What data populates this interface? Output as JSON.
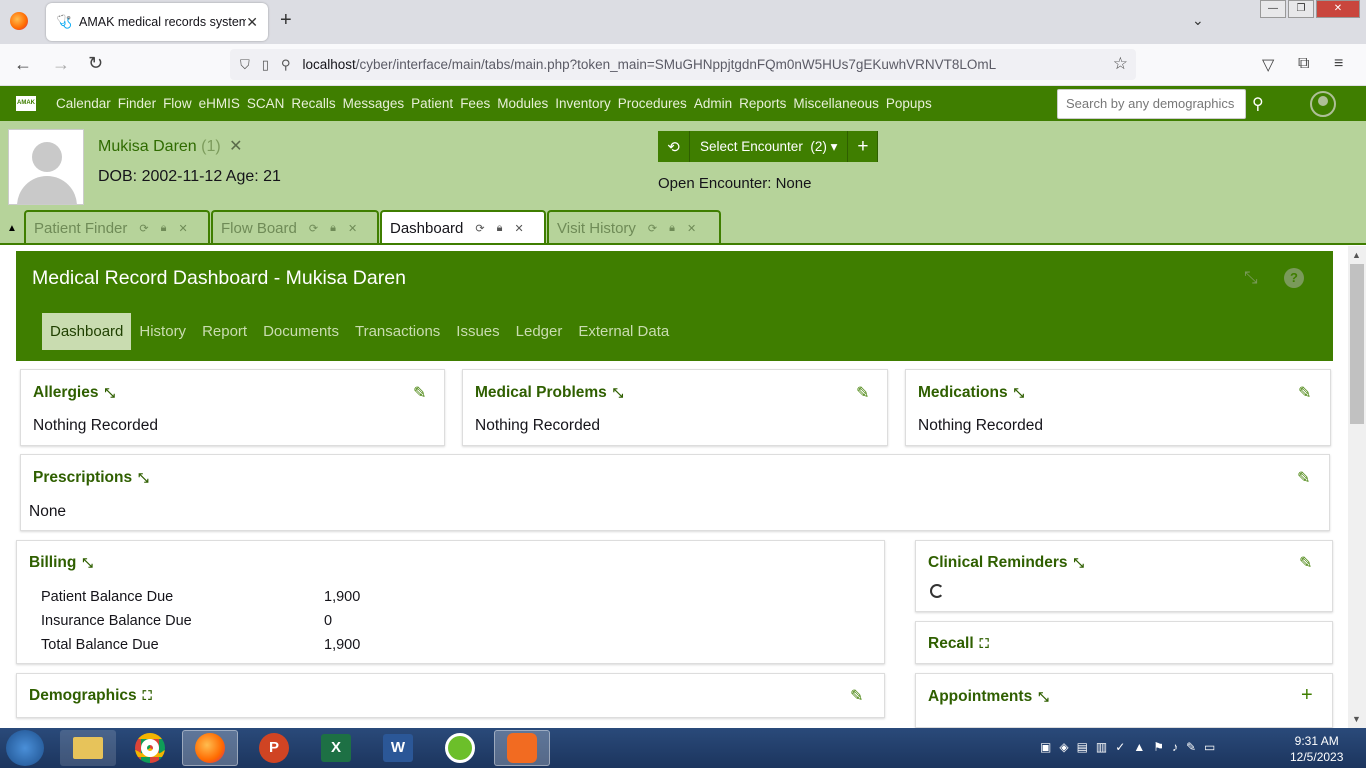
{
  "browser": {
    "tab_title": "AMAK medical records system",
    "url_host": "localhost",
    "url_path": "/cyber/interface/main/tabs/main.php?token_main=SMuGHNppjtgdnFQm0nW5HUs7gEKuwhVRNVT8LOmL"
  },
  "app": {
    "logo_text": "AMAK",
    "menu": [
      "Calendar",
      "Finder",
      "Flow",
      "eHMIS",
      "SCAN",
      "Recalls",
      "Messages",
      "Patient",
      "Fees",
      "Modules",
      "Inventory",
      "Procedures",
      "Admin",
      "Reports",
      "Miscellaneous",
      "Popups"
    ],
    "search_placeholder": "Search by any demographics"
  },
  "patient": {
    "name": "Mukisa Daren",
    "count": "(1)",
    "dob_line": "DOB: 2002-11-12 Age: 21",
    "select_encounter": "Select Encounter",
    "encounter_count": "(2)",
    "open_encounter": "Open Encounter: None"
  },
  "tabs": [
    {
      "label": "Patient Finder"
    },
    {
      "label": "Flow Board"
    },
    {
      "label": "Dashboard"
    },
    {
      "label": "Visit History"
    }
  ],
  "dashboard": {
    "title": "Medical Record Dashboard - Mukisa Daren",
    "nav": [
      "Dashboard",
      "History",
      "Report",
      "Documents",
      "Transactions",
      "Issues",
      "Ledger",
      "External Data"
    ]
  },
  "cards": {
    "allergies": {
      "title": "Allergies",
      "body": "Nothing Recorded"
    },
    "medical_problems": {
      "title": "Medical Problems",
      "body": "Nothing Recorded"
    },
    "medications": {
      "title": "Medications",
      "body": "Nothing Recorded"
    },
    "prescriptions": {
      "title": "Prescriptions",
      "body": "None"
    },
    "billing": {
      "title": "Billing",
      "rows": [
        {
          "label": "Patient Balance Due",
          "value": "1,900"
        },
        {
          "label": "Insurance Balance Due",
          "value": "0"
        },
        {
          "label": "Total Balance Due",
          "value": "1,900"
        }
      ]
    },
    "clinical_reminders": {
      "title": "Clinical Reminders"
    },
    "recall": {
      "title": "Recall"
    },
    "demographics": {
      "title": "Demographics"
    },
    "appointments": {
      "title": "Appointments"
    }
  },
  "taskbar": {
    "time": "9:31 AM",
    "date": "12/5/2023",
    "apps": [
      "P",
      "X",
      "W"
    ]
  },
  "colors": {
    "brand": "#3f7e00",
    "header_bg": "#b6d39a",
    "card_title": "#2f5f00"
  }
}
